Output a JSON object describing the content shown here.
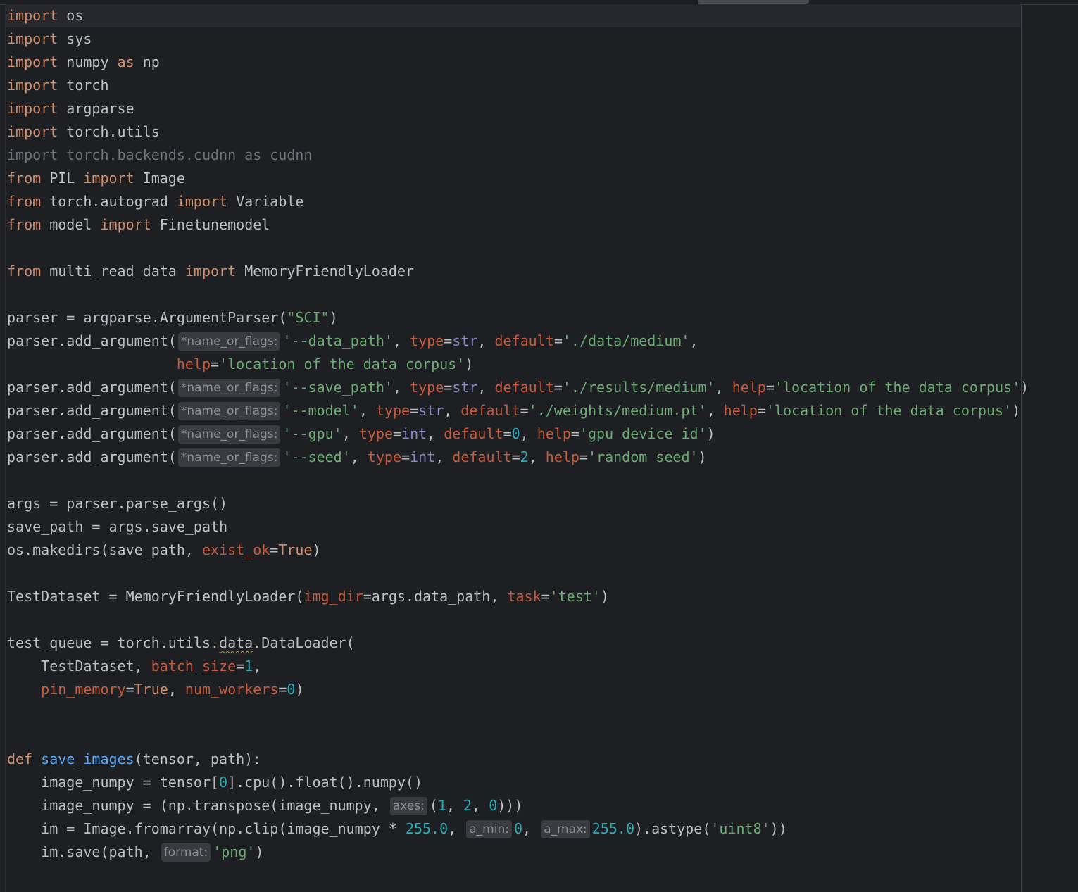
{
  "editor": {
    "language": "python",
    "colors": {
      "background": "#1e1f22",
      "text": "#bcbec4",
      "keyword": "#cf8e6d",
      "string": "#6aab73",
      "number": "#2aacb8",
      "named_parameter": "#c55a3d",
      "builtin": "#8888c6",
      "function_name": "#56a8f5",
      "unused_import": "#6f737a",
      "inlay_hint_bg": "#393b40"
    },
    "inlay_hints": {
      "name_or_flags": "*name_or_flags:",
      "axes": "axes:",
      "a_min": "a_min:",
      "a_max": "a_max:",
      "format": "format:"
    },
    "code": {
      "l1": "os",
      "l2": "sys",
      "l3a": "numpy",
      "l3b": "np",
      "l4": "torch",
      "l5": "argparse",
      "l6": "torch.utils",
      "l7": "import torch.backends.cudnn as cudnn",
      "l8a": "PIL",
      "l8b": "Image",
      "l9a": "torch.autograd",
      "l9b": "Variable",
      "l10a": "model",
      "l10b": "Finetunemodel",
      "l12a": "multi_read_data",
      "l12b": "MemoryFriendlyLoader",
      "l14a": "parser = argparse.ArgumentParser(",
      "l14b": "\"SCI\"",
      "l15_data_path": "'--data_path'",
      "l15_default": "'./data/medium'",
      "l16_help": "'location of the data corpus'",
      "l17_save_path": "'--save_path'",
      "l17_default": "'./results/medium'",
      "l17_help": "'location of the data corpus'",
      "l18_model": "'--model'",
      "l18_default": "'./weights/medium.pt'",
      "l18_help": "'location of the data corpus'",
      "l19_gpu": "'--gpu'",
      "l19_default": "0",
      "l19_help": "'gpu device id'",
      "l20_seed": "'--seed'",
      "l20_default": "2",
      "l20_help": "'random seed'",
      "l22": "args = parser.parse_args()",
      "l23": "save_path = args.save_path",
      "l24": "os.makedirs(save_path, ",
      "l26a": "TestDataset = MemoryFriendlyLoader(",
      "l26b": "=args.data_path, ",
      "l26c": "'test'",
      "l28a": "test_queue = torch.utils.",
      "l28b": "data",
      "l28c": ".DataLoader(",
      "l29": "    TestDataset, ",
      "l29_batch": "1",
      "l30_workers": "0",
      "l33_fn": "save_images",
      "l33_args": "(tensor, path):",
      "l34a": "    image_numpy = tensor[",
      "l34_idx": "0",
      "l34b": "].cpu().float().numpy()",
      "l35a": "    image_numpy = (np.transpose(image_numpy, ",
      "l35_n1": "1",
      "l35_n2": "2",
      "l35_n3": "0",
      "l36a": "    im = Image.fromarray(np.clip(image_numpy * ",
      "l36_n1": "255.0",
      "l36_n2": "0",
      "l36_n3": "255.0",
      "l36_u8": "'uint8'",
      "l37a": "    im.save(path, ",
      "l37_png": "'png'"
    }
  }
}
